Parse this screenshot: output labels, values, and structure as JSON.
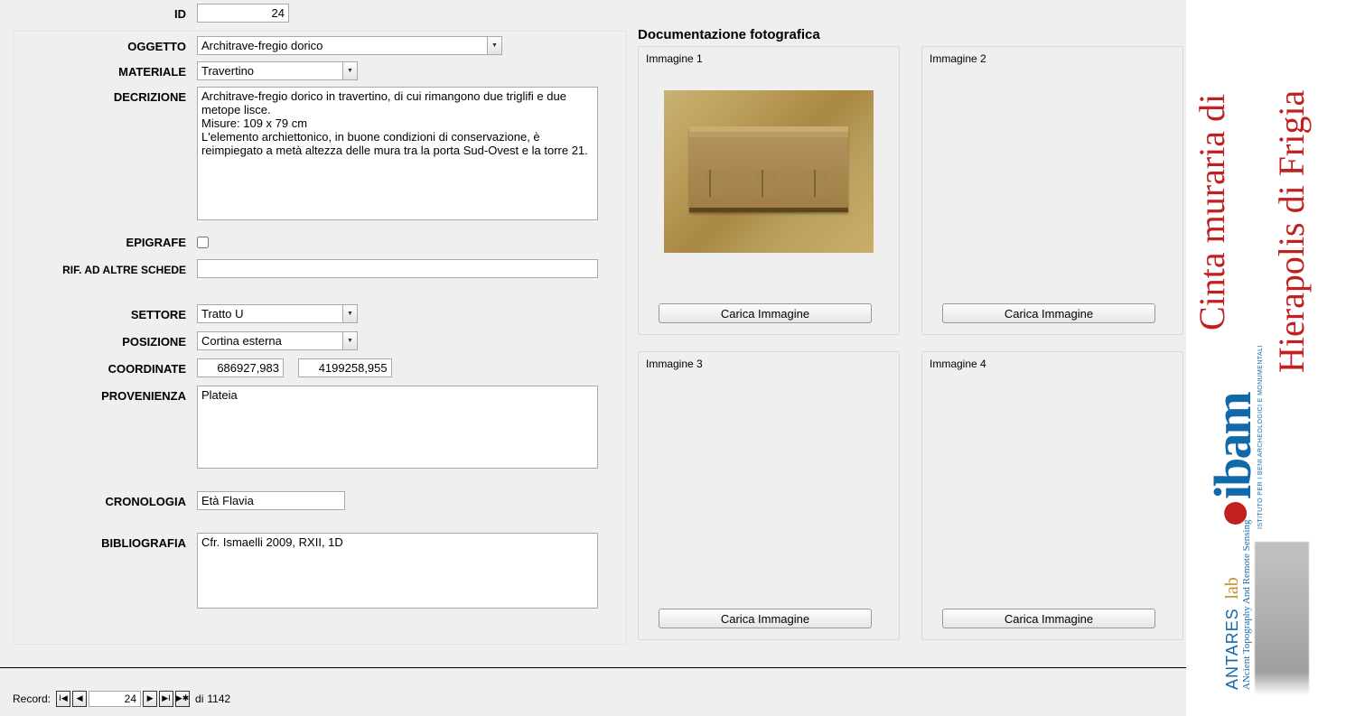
{
  "form": {
    "id_label": "ID",
    "id_value": "24",
    "oggetto_label": "OGGETTO",
    "oggetto_value": "Architrave-fregio dorico",
    "materiale_label": "MATERIALE",
    "materiale_value": "Travertino",
    "descrizione_label": "DECRIZIONE",
    "descrizione_value": "Architrave-fregio dorico in travertino, di cui rimangono due triglifi e due metope lisce.\nMisure: 109 x 79 cm\nL'elemento archiettonico, in buone condizioni di conservazione, è reimpiegato a metà altezza delle mura tra la porta Sud-Ovest e la torre 21.",
    "epigrafe_label": "EPIGRAFE",
    "epigrafe_checked": false,
    "rif_label": "RIF. AD ALTRE SCHEDE",
    "rif_value": "",
    "settore_label": "SETTORE",
    "settore_value": "Tratto U",
    "posizione_label": "POSIZIONE",
    "posizione_value": "Cortina esterna",
    "coord_label": "COORDINATE",
    "coord_x": "686927,983",
    "coord_y": "4199258,955",
    "prov_label": "PROVENIENZA",
    "prov_value": "Plateia",
    "crono_label": "CRONOLOGIA",
    "crono_value": "Età Flavia",
    "biblio_label": "BIBLIOGRAFIA",
    "biblio_value": "Cfr. Ismaelli 2009, RXII, 1D"
  },
  "photos": {
    "section_title": "Documentazione fotografica",
    "img1_label": "Immagine 1",
    "img2_label": "Immagine 2",
    "img3_label": "Immagine 3",
    "img4_label": "Immagine 4",
    "load_label": "Carica Immagine"
  },
  "nav": {
    "record_label": "Record:",
    "current": "24",
    "of_label": "di",
    "total": "1142"
  },
  "sidebar": {
    "title_line1": "Cinta muraria di",
    "title_line2": "Hierapolis di Frigia",
    "ibam": "ibam",
    "ibam_sub": "ISTITUTO PER I BENI ARCHEOLOGICI E MONUMENTALI",
    "antares1": "ANTARES",
    "antares2": "lab",
    "antares3": "ANcient Topography And Remote Sensing"
  }
}
